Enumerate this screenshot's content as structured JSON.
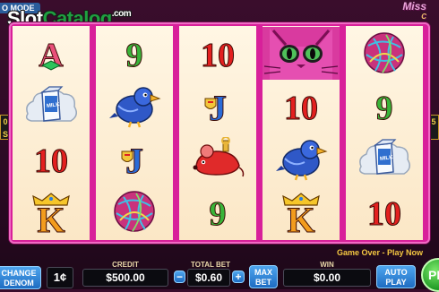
{
  "top": {
    "mode_tag": "O MODE",
    "watermark_pre": "Slot",
    "watermark_cat": "Catalog",
    "watermark_com": ".com",
    "game_logo": "Miss",
    "game_logo_sub": "C"
  },
  "side_left": [
    "0",
    "S"
  ],
  "side_right": [
    "5",
    ""
  ],
  "reels": [
    [
      {
        "symbol": "A",
        "kind": "letter",
        "color": "#e94f7a"
      },
      {
        "symbol": "milk",
        "kind": "milk",
        "label": "MILK"
      },
      {
        "symbol": "10",
        "kind": "number",
        "color": "#e3201f"
      },
      {
        "symbol": "K",
        "kind": "king",
        "color": "#f39c1d"
      }
    ],
    [
      {
        "symbol": "9",
        "kind": "number",
        "color": "#39b439"
      },
      {
        "symbol": "bird",
        "kind": "bird"
      },
      {
        "symbol": "J",
        "kind": "jack",
        "color": "#2a6bd8"
      },
      {
        "symbol": "yarn",
        "kind": "yarn"
      }
    ],
    [
      {
        "symbol": "10",
        "kind": "number",
        "color": "#e3201f"
      },
      {
        "symbol": "J",
        "kind": "jack",
        "color": "#2a6bd8"
      },
      {
        "symbol": "mouse",
        "kind": "mouse"
      },
      {
        "symbol": "9",
        "kind": "number",
        "color": "#39b439"
      }
    ],
    [
      {
        "symbol": "kitty",
        "kind": "kitty"
      },
      {
        "symbol": "10",
        "kind": "number",
        "color": "#e3201f"
      },
      {
        "symbol": "bird",
        "kind": "bird"
      },
      {
        "symbol": "K",
        "kind": "king",
        "color": "#f39c1d"
      }
    ],
    [
      {
        "symbol": "yarn",
        "kind": "yarn"
      },
      {
        "symbol": "9",
        "kind": "number",
        "color": "#39b439"
      },
      {
        "symbol": "milk",
        "kind": "milk",
        "label": "MILK"
      },
      {
        "symbol": "10",
        "kind": "number",
        "color": "#e3201f"
      }
    ]
  ],
  "status_message": "Game Over - Play Now",
  "controls": {
    "change_denom_line1": "CHANGE",
    "change_denom_line2": "DENOM",
    "denom_value": "1¢",
    "credit_label": "CREDIT",
    "credit_value": "$500.00",
    "total_bet_label": "TOTAL BET",
    "minus": "−",
    "total_bet_value": "$0.60",
    "plus": "+",
    "max_bet_line1": "MAX",
    "max_bet_line2": "BET",
    "win_label": "WIN",
    "win_value": "$0.00",
    "auto_play_line1": "AUTO",
    "auto_play_line2": "PLAY",
    "play_label": "PL"
  },
  "colors": {
    "frame": "#d8209a",
    "reel_bg": "#fbe7c6",
    "accent_blue": "#1e6cc2",
    "message": "#f5c842"
  }
}
